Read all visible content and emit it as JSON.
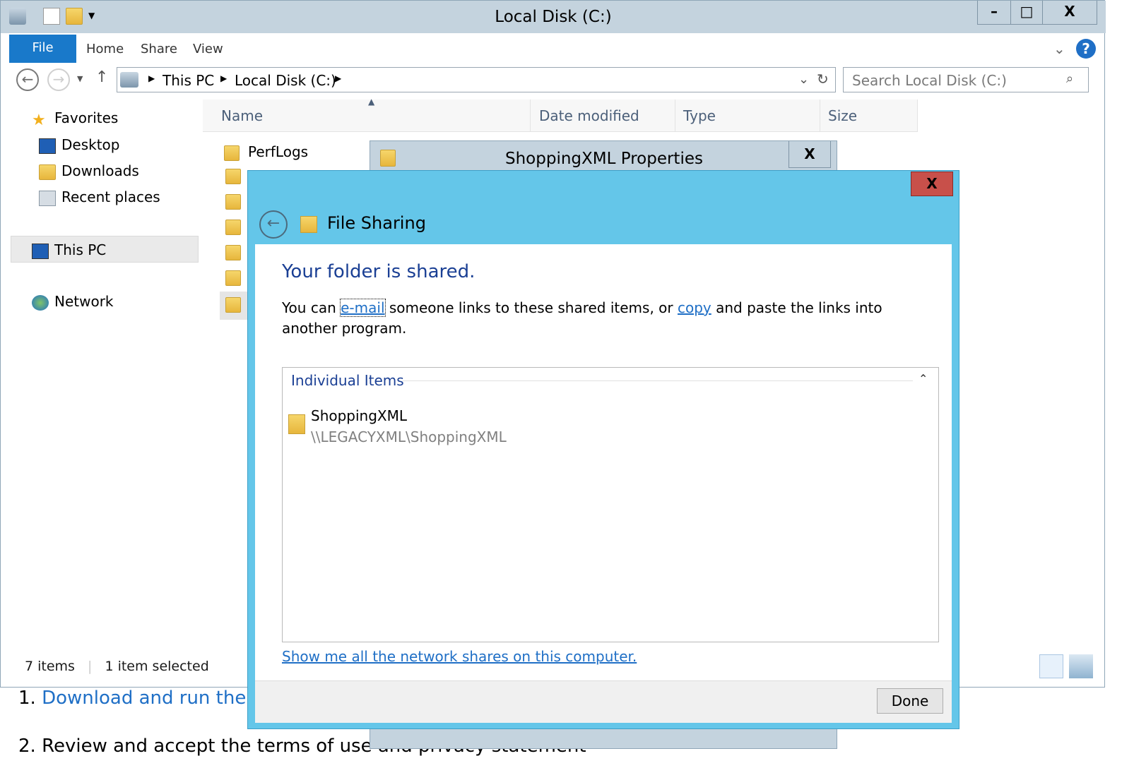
{
  "explorer": {
    "title": "Local Disk (C:)",
    "window_buttons": {
      "minimize": "–",
      "maximize": "□",
      "close": "X"
    },
    "ribbon": {
      "file": "File",
      "tabs": [
        "Home",
        "Share",
        "View"
      ],
      "help": "?"
    },
    "address": {
      "crumbs": [
        "This PC",
        "Local Disk (C:)"
      ],
      "search_placeholder": "Search Local Disk (C:)"
    },
    "nav": {
      "favorites": "Favorites",
      "desktop": "Desktop",
      "downloads": "Downloads",
      "recent": "Recent places",
      "this_pc": "This PC",
      "network": "Network"
    },
    "columns": [
      "Name",
      "Date modified",
      "Type",
      "Size"
    ],
    "files": [
      "PerfLogs"
    ],
    "status": {
      "count": "7 items",
      "selected": "1 item selected"
    }
  },
  "page": {
    "line1_prefix": "1. ",
    "line1_link": "Download and run the g",
    "line2": "2. Review and accept the terms of use and privacy statement"
  },
  "properties_dialog": {
    "title": "ShoppingXML Properties",
    "close": "X"
  },
  "sharing_dialog": {
    "title": "File Sharing",
    "close": "X",
    "heading": "Your folder is shared.",
    "desc_before": "You can ",
    "desc_email": "e-mail",
    "desc_middle": " someone links to these shared items, or ",
    "desc_copy": "copy",
    "desc_after": " and paste the links into another program.",
    "group_header": "Individual Items",
    "item_name": "ShoppingXML",
    "item_path": "\\\\LEGACYXML\\ShoppingXML",
    "network_link": "Show me all the network shares on this computer.",
    "done": "Done"
  }
}
